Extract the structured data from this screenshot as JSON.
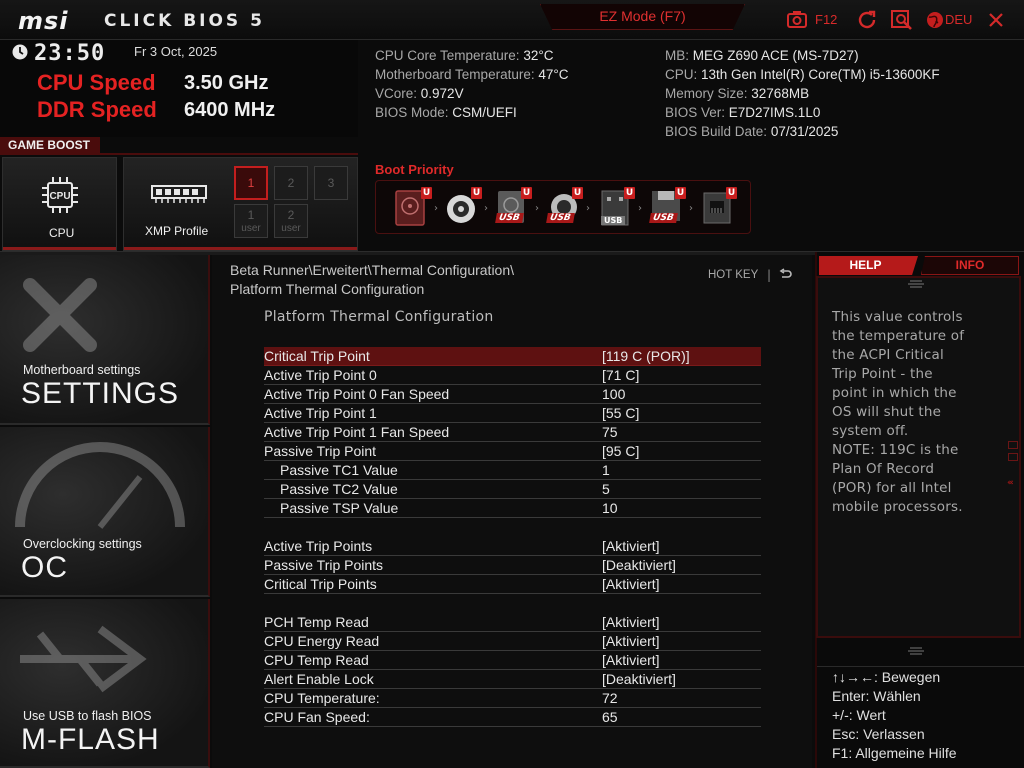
{
  "header": {
    "brand": "msi",
    "product": "CLICK BIOS 5",
    "ez_mode": "EZ Mode (F7)",
    "f12_label": "F12",
    "language": "DEU",
    "icons": [
      "screenshot-icon",
      "refresh-icon",
      "search-icon",
      "globe-icon",
      "close-icon"
    ],
    "accent_color": "#d42a2a"
  },
  "status": {
    "time": "23:50",
    "date": "Fr  3 Oct, 2025",
    "cpu_speed_label": "CPU Speed",
    "cpu_speed_value": "3.50 GHz",
    "ddr_speed_label": "DDR Speed",
    "ddr_speed_value": "6400 MHz"
  },
  "game_boost": {
    "label": "GAME BOOST",
    "cpu_tile": "CPU",
    "cpu_chip_text": "CPU",
    "xmp_tile": "XMP Profile",
    "xmp_buttons": [
      "1",
      "2",
      "3"
    ],
    "xmp_user_buttons": [
      {
        "num": "1",
        "label": "user"
      },
      {
        "num": "2",
        "label": "user"
      }
    ],
    "xmp_selected": "1"
  },
  "sysinfo": {
    "left": [
      {
        "label": "CPU Core Temperature: ",
        "value": "32°C"
      },
      {
        "label": "Motherboard Temperature: ",
        "value": "47°C"
      },
      {
        "label": "VCore: ",
        "value": "0.972V"
      },
      {
        "label": "BIOS Mode: ",
        "value": "CSM/UEFI"
      }
    ],
    "right": [
      {
        "label": "MB: ",
        "value": "MEG Z690 ACE (MS-7D27)"
      },
      {
        "label": "CPU: ",
        "value": "13th Gen Intel(R) Core(TM) i5-13600KF"
      },
      {
        "label": "Memory Size: ",
        "value": "32768MB"
      },
      {
        "label": "BIOS Ver: ",
        "value": "E7D27IMS.1L0"
      },
      {
        "label": "BIOS Build Date: ",
        "value": "07/31/2025"
      }
    ]
  },
  "boot": {
    "title": "Boot Priority",
    "badge": "U",
    "usb_tag": "USB",
    "devices": [
      "hdd",
      "optical-disc",
      "usb-hdd",
      "usb-optical",
      "usb-drive",
      "usb-floppy",
      "network"
    ]
  },
  "nav": {
    "settings_sub": "Motherboard settings",
    "settings_main": "SETTINGS",
    "oc_sub": "Overclocking settings",
    "oc_main": "OC",
    "mflash_sub": "Use USB to flash BIOS",
    "mflash_main": "M-FLASH"
  },
  "main": {
    "breadcrumb": "Beta Runner\\Erweitert\\Thermal Configuration\\",
    "breadcrumb2": "Platform Thermal Configuration",
    "hotkey": "HOT KEY",
    "hotkey_sep": "|",
    "section_title": "Platform Thermal Configuration",
    "rows": [
      {
        "key": "Critical Trip Point",
        "value": "[119 C (POR)]"
      },
      {
        "key": "Active Trip Point 0",
        "value": "[71 C]"
      },
      {
        "key": "Active Trip Point 0 Fan Speed",
        "value": "100"
      },
      {
        "key": "Active Trip Point 1",
        "value": "[55 C]"
      },
      {
        "key": "Active Trip Point 1 Fan Speed",
        "value": "75"
      },
      {
        "key": "Passive Trip Point",
        "value": "[95 C]"
      },
      {
        "key": "Passive TC1 Value",
        "value": "1"
      },
      {
        "key": "Passive TC2 Value",
        "value": "5"
      },
      {
        "key": "Passive TSP Value",
        "value": "10"
      },
      {
        "key": "Active Trip Points",
        "value": "[Aktiviert]"
      },
      {
        "key": "Passive Trip Points",
        "value": "[Deaktiviert]"
      },
      {
        "key": "Critical Trip Points",
        "value": "[Aktiviert]"
      },
      {
        "key": "PCH Temp Read",
        "value": "[Aktiviert]"
      },
      {
        "key": "CPU Energy Read",
        "value": "[Aktiviert]"
      },
      {
        "key": "CPU Temp Read",
        "value": "[Aktiviert]"
      },
      {
        "key": "Alert Enable Lock",
        "value": "[Deaktiviert]"
      },
      {
        "key": "CPU Temperature:",
        "value": "72"
      },
      {
        "key": "CPU Fan Speed:",
        "value": "65"
      }
    ]
  },
  "help": {
    "tab_help": "HELP",
    "tab_info": "INFO",
    "text": "This value controls\nthe temperature of\nthe ACPI Critical\nTrip Point - the\npoint in which the\nOS will shut the\nsystem off.\nNOTE:  119C is the\nPlan Of Record\n(POR) for all Intel\nmobile processors.",
    "keys": [
      "↑↓→←: Bewegen",
      "Enter: Wählen",
      "+/-: Wert",
      "Esc: Verlassen",
      "F1: Allgemeine Hilfe"
    ]
  }
}
